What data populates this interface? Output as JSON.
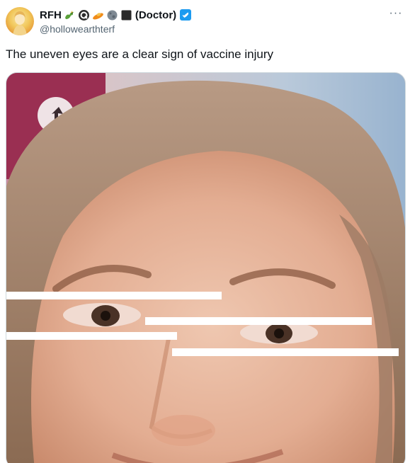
{
  "author": {
    "display_name": "RFH",
    "name_suffix": "(Doctor)",
    "handle": "@hollowearthterf",
    "name_emojis": [
      "dragon-emoji",
      "q-circle-emoji",
      "flying-saucer-emoji",
      "moon-emoji",
      "black-square-emoji"
    ],
    "verified": true
  },
  "tweet": {
    "text": "The uneven eyes are a clear sign of vaccine injury"
  },
  "menu": {
    "more_label": "···"
  },
  "colors": {
    "text_primary": "#0f1419",
    "text_secondary": "#536471",
    "verified_blue": "#1d9bf0",
    "media_border": "#cfd9de"
  }
}
